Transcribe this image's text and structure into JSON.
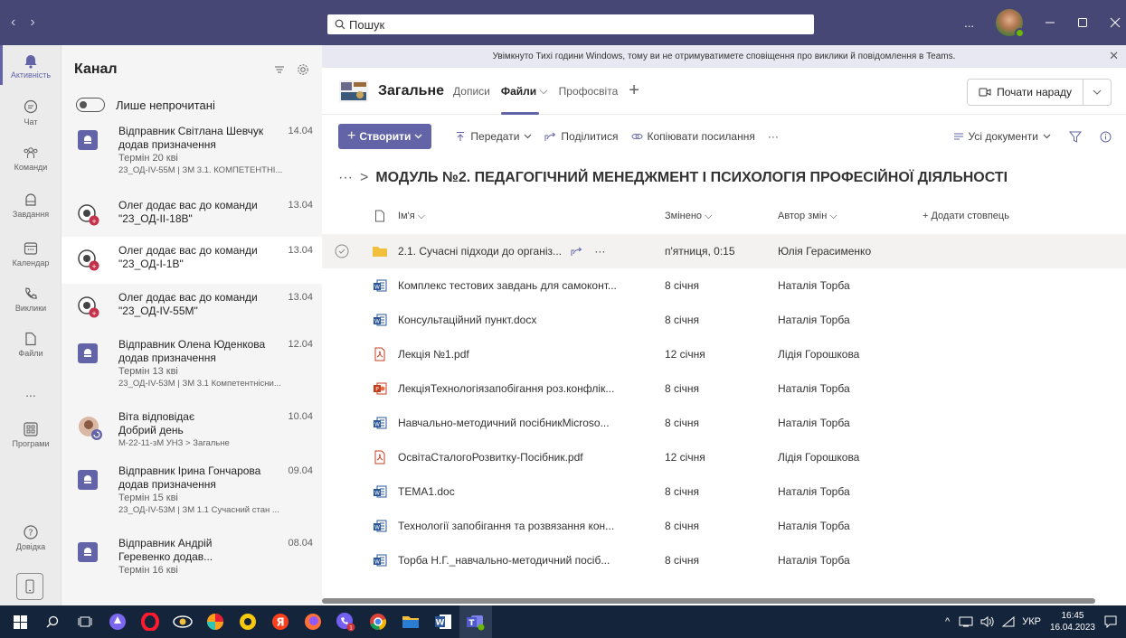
{
  "search": {
    "placeholder": "Пошук"
  },
  "titlebar": {
    "more": "..."
  },
  "rail": [
    {
      "label": "Активність",
      "icon": "bell-icon"
    },
    {
      "label": "Чат",
      "icon": "chat-icon"
    },
    {
      "label": "Команди",
      "icon": "teams-icon"
    },
    {
      "label": "Завдання",
      "icon": "assignments-icon"
    },
    {
      "label": "Календар",
      "icon": "calendar-icon"
    },
    {
      "label": "Виклики",
      "icon": "phone-icon"
    },
    {
      "label": "Файли",
      "icon": "file-icon"
    },
    {
      "label": "...",
      "icon": "more-icon"
    },
    {
      "label": "Програми",
      "icon": "apps-icon"
    },
    {
      "label": "Довідка",
      "icon": "help-icon"
    }
  ],
  "activity": {
    "title": "Канал",
    "unread_toggle": "Лише непрочитані",
    "items": [
      {
        "title": "Відправник Світлана Шевчук",
        "date": "14.04",
        "line2": "додав призначення",
        "line3": "Термін 20 кві",
        "line4": "23_ОД-IV-55М | ЗМ 3.1. КОМПЕТЕНТНІ...",
        "type": "assignment"
      },
      {
        "title": "Олег додає вас до команди",
        "date": "13.04",
        "line2": "\"23_ОД-ІІ-18В\"",
        "type": "team"
      },
      {
        "title": "Олег додає вас до команди",
        "date": "13.04",
        "line2": "\"23_ОД-І-1В\"",
        "type": "team"
      },
      {
        "title": "Олег додає вас до команди",
        "date": "13.04",
        "line2": "\"23_ОД-IV-55М\"",
        "type": "team"
      },
      {
        "title": "Відправник Олена Юденкова",
        "date": "12.04",
        "line2": "додав призначення",
        "line3": "Термін 13 кві",
        "line4": "23_ОД-IV-53М | ЗМ 3.1 Компетентнісни...",
        "type": "assignment"
      },
      {
        "title": "Віта відповідає",
        "date": "10.04",
        "line2": "Добрий день",
        "line4": "М-22-11-зМ УНЗ > Загальне",
        "type": "reply"
      },
      {
        "title": "Відправник Ірина Гончарова",
        "date": "09.04",
        "line2": "додав призначення",
        "line3": "Термін 15 кві",
        "line4": "23_ОД-IV-53М | ЗМ 1.1 Сучасний стан ...",
        "type": "assignment"
      },
      {
        "title": "Відправник Андрій",
        "date": "08.04",
        "line2": "Геревенко додав...",
        "line3": "Термін 16 кві",
        "type": "assignment"
      }
    ]
  },
  "banner": {
    "text": "Увімкнуто Тихі години Windows, тому ви не отримуватимете сповіщення про виклики й повідомлення в Teams."
  },
  "channel": {
    "name": "Загальне",
    "tabs": [
      "Дописи",
      "Файли",
      "Профосвіта"
    ],
    "meet_label": "Почати нараду"
  },
  "toolbar": {
    "create": "Створити",
    "upload": "Передати",
    "share": "Поділитися",
    "copy_link": "Копіювати посилання",
    "more": "···",
    "view": "Усі документи"
  },
  "breadcrumb": {
    "dots": "···",
    "folder": "МОДУЛЬ №2. ПЕДАГОГІЧНИЙ МЕНЕДЖМЕНТ І ПСИХОЛОГІЯ ПРОФЕСІЙНОЇ ДІЯЛЬНОСТІ"
  },
  "table": {
    "headers": {
      "name": "Ім'я",
      "modified": "Змінено",
      "author": "Автор змін",
      "add": "+ Додати стовпець"
    },
    "rows": [
      {
        "type": "folder",
        "name": "2.1. Сучасні підходи до організ...",
        "modified": "п'ятниця, 0:15",
        "author": "Юлія Герасименко"
      },
      {
        "type": "word",
        "name": "Комплекс тестових завдань для самоконт...",
        "modified": "8 січня",
        "author": "Наталія Торба"
      },
      {
        "type": "word",
        "name": "Консультаційний пункт.docx",
        "modified": "8 січня",
        "author": "Наталія Торба"
      },
      {
        "type": "pdf",
        "name": "Лекція №1.pdf",
        "modified": "12 січня",
        "author": "Лідія Горошкова"
      },
      {
        "type": "ppt",
        "name": "ЛекціяТехнологіязапобігання роз.конфлік...",
        "modified": "8 січня",
        "author": "Наталія Торба"
      },
      {
        "type": "word",
        "name": "Навчально-методичний посібникMicroso...",
        "modified": "8 січня",
        "author": "Наталія Торба"
      },
      {
        "type": "pdf",
        "name": "ОсвітаСталогоРозвитку-Посібник.pdf",
        "modified": "12 січня",
        "author": "Лідія Горошкова"
      },
      {
        "type": "word",
        "name": "ТЕМА1.doc",
        "modified": "8 січня",
        "author": "Наталія Торба"
      },
      {
        "type": "word",
        "name": "Технології запобігання та розвязання кон...",
        "modified": "8 січня",
        "author": "Наталія Торба"
      },
      {
        "type": "word",
        "name": "Торба Н.Г._навчально-методичний посіб...",
        "modified": "8 січня",
        "author": "Наталія Торба"
      }
    ],
    "row_more": "···"
  },
  "taskbar": {
    "lang": "УКР",
    "time": "16:45",
    "date": "16.04.2023"
  },
  "colors": {
    "teams": "#464775",
    "accent": "#6264a7",
    "taskbar": "#14243a"
  }
}
